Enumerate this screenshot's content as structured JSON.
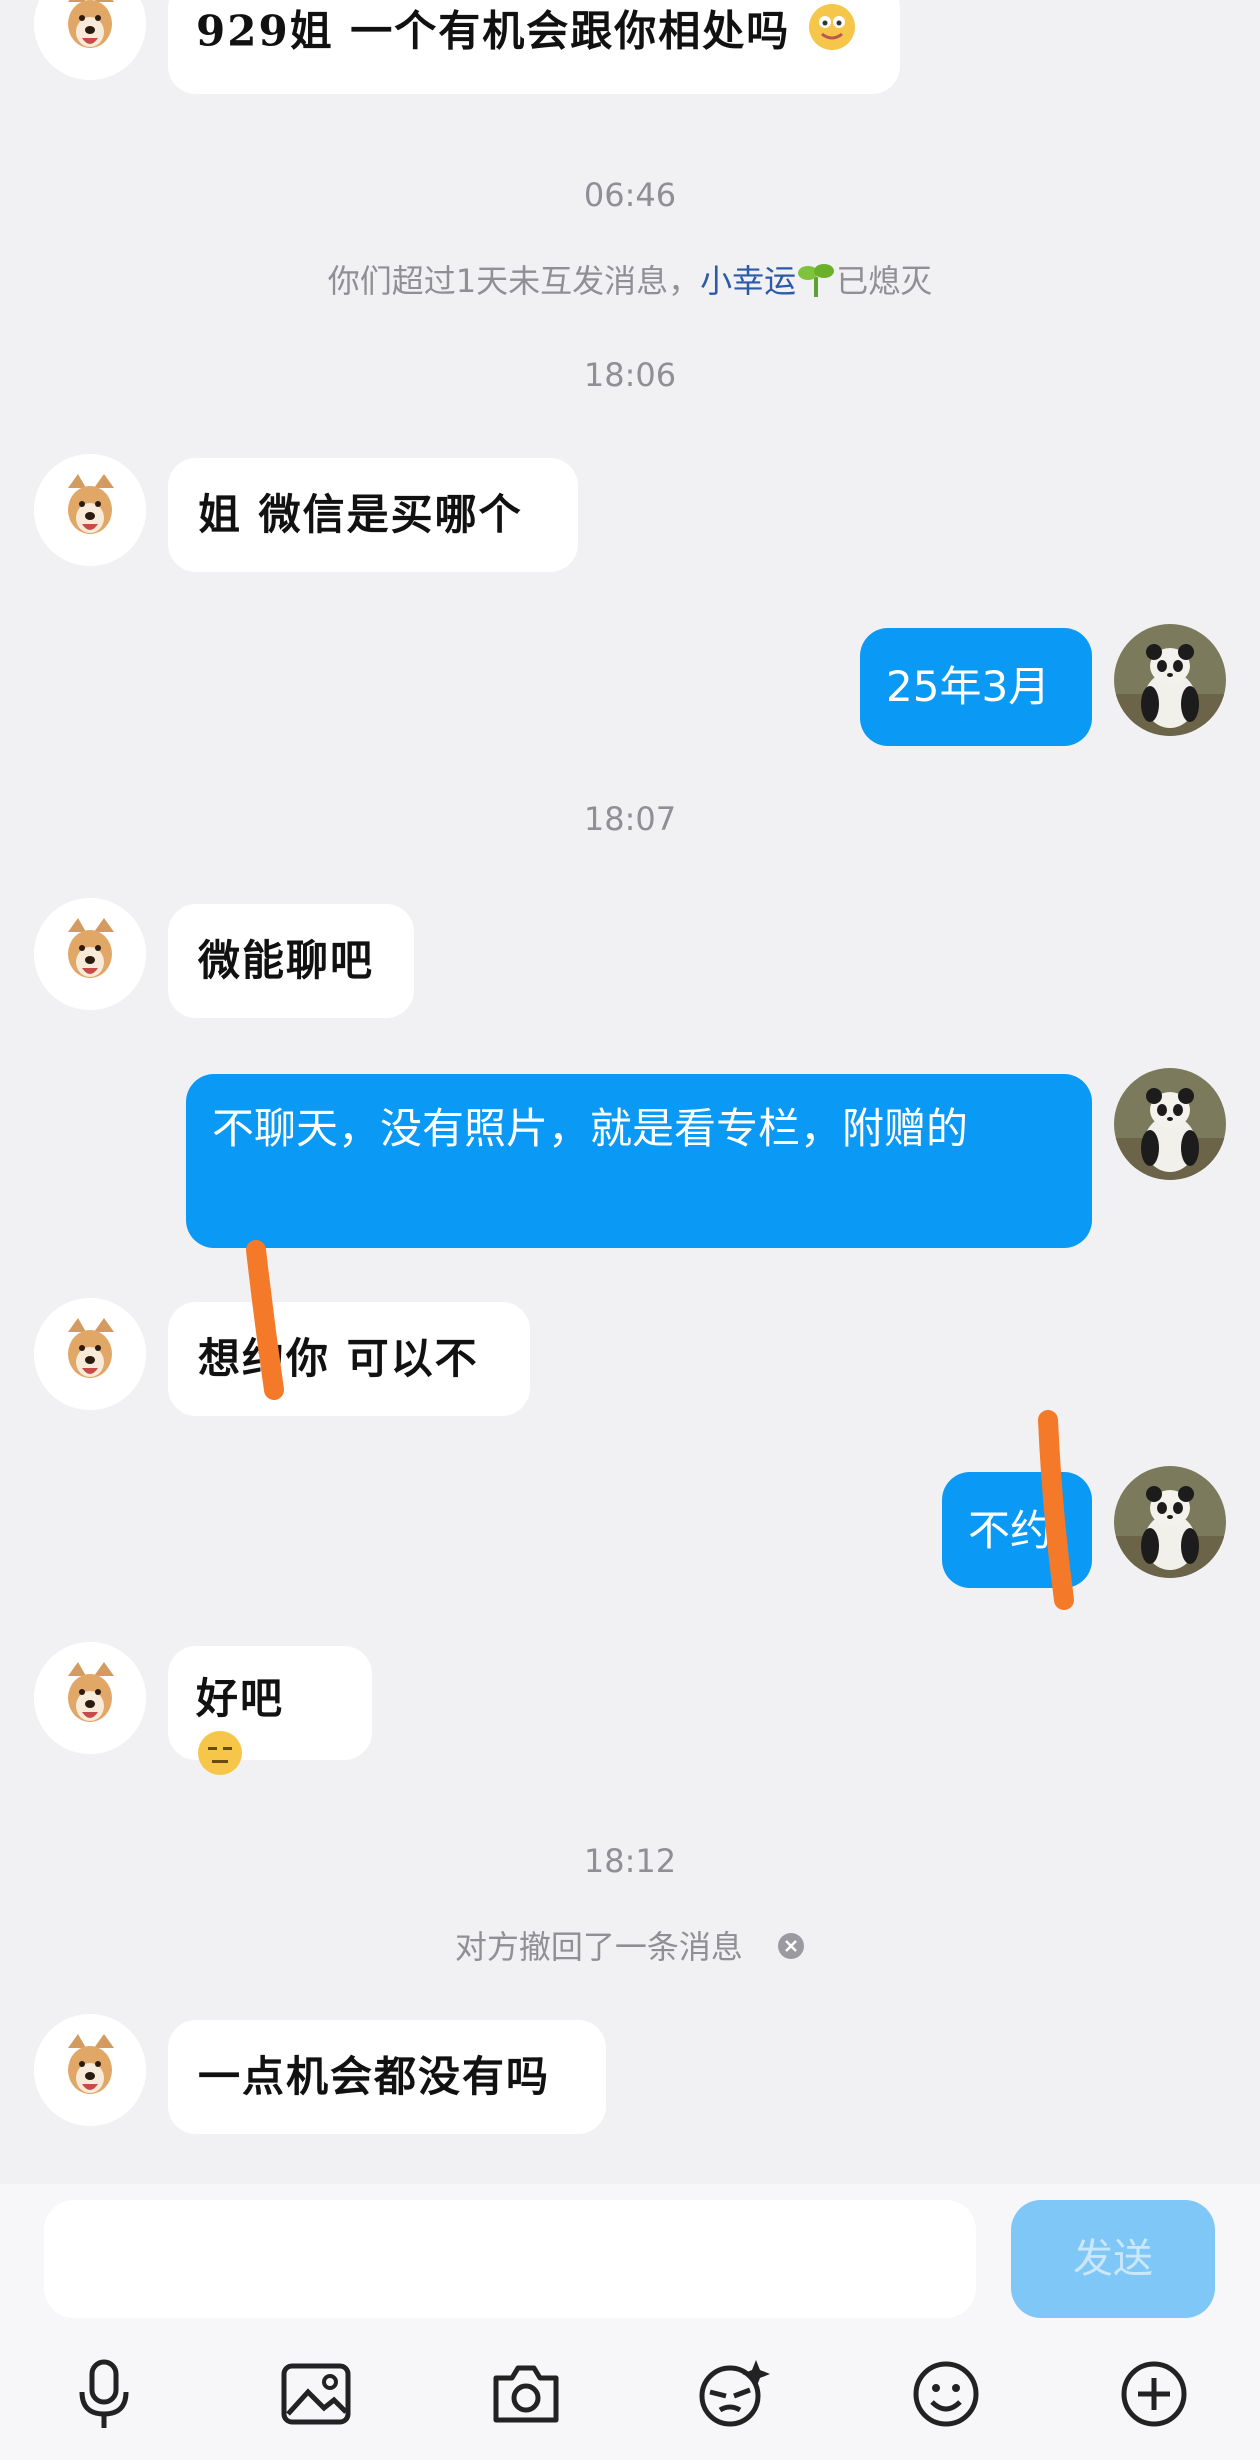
{
  "messages": {
    "m0": "929姐 一个有机会跟你相处吗",
    "t1": "06:46",
    "notice1_pre": "你们超过1天未互发消息，",
    "notice1_link": "小幸运",
    "notice1_post": "已熄灭",
    "t2": "18:06",
    "m1": "姐 微信是买哪个",
    "m2": "25年3月",
    "t3": "18:07",
    "m3": "微能聊吧",
    "m4": "不聊天，没有照片，就是看专栏，附赠的",
    "m5": "想约你 可以不",
    "m6": "不约",
    "m7": "好吧",
    "t4": "18:12",
    "notice2": "对方撤回了一条消息",
    "m8": "一点机会都没有吗"
  },
  "composer": {
    "input_value": "",
    "send_label": "发送"
  },
  "toolbar": [
    "microphone-icon",
    "image-icon",
    "camera-icon",
    "sticker-icon",
    "emoji-icon",
    "plus-icon"
  ],
  "colors": {
    "background": "#f1f1f3",
    "outgoing_bubble": "#0a99f5",
    "incoming_bubble": "#ffffff",
    "send_button": "#7fc7f7",
    "redaction_mark": "#f47a2a"
  }
}
